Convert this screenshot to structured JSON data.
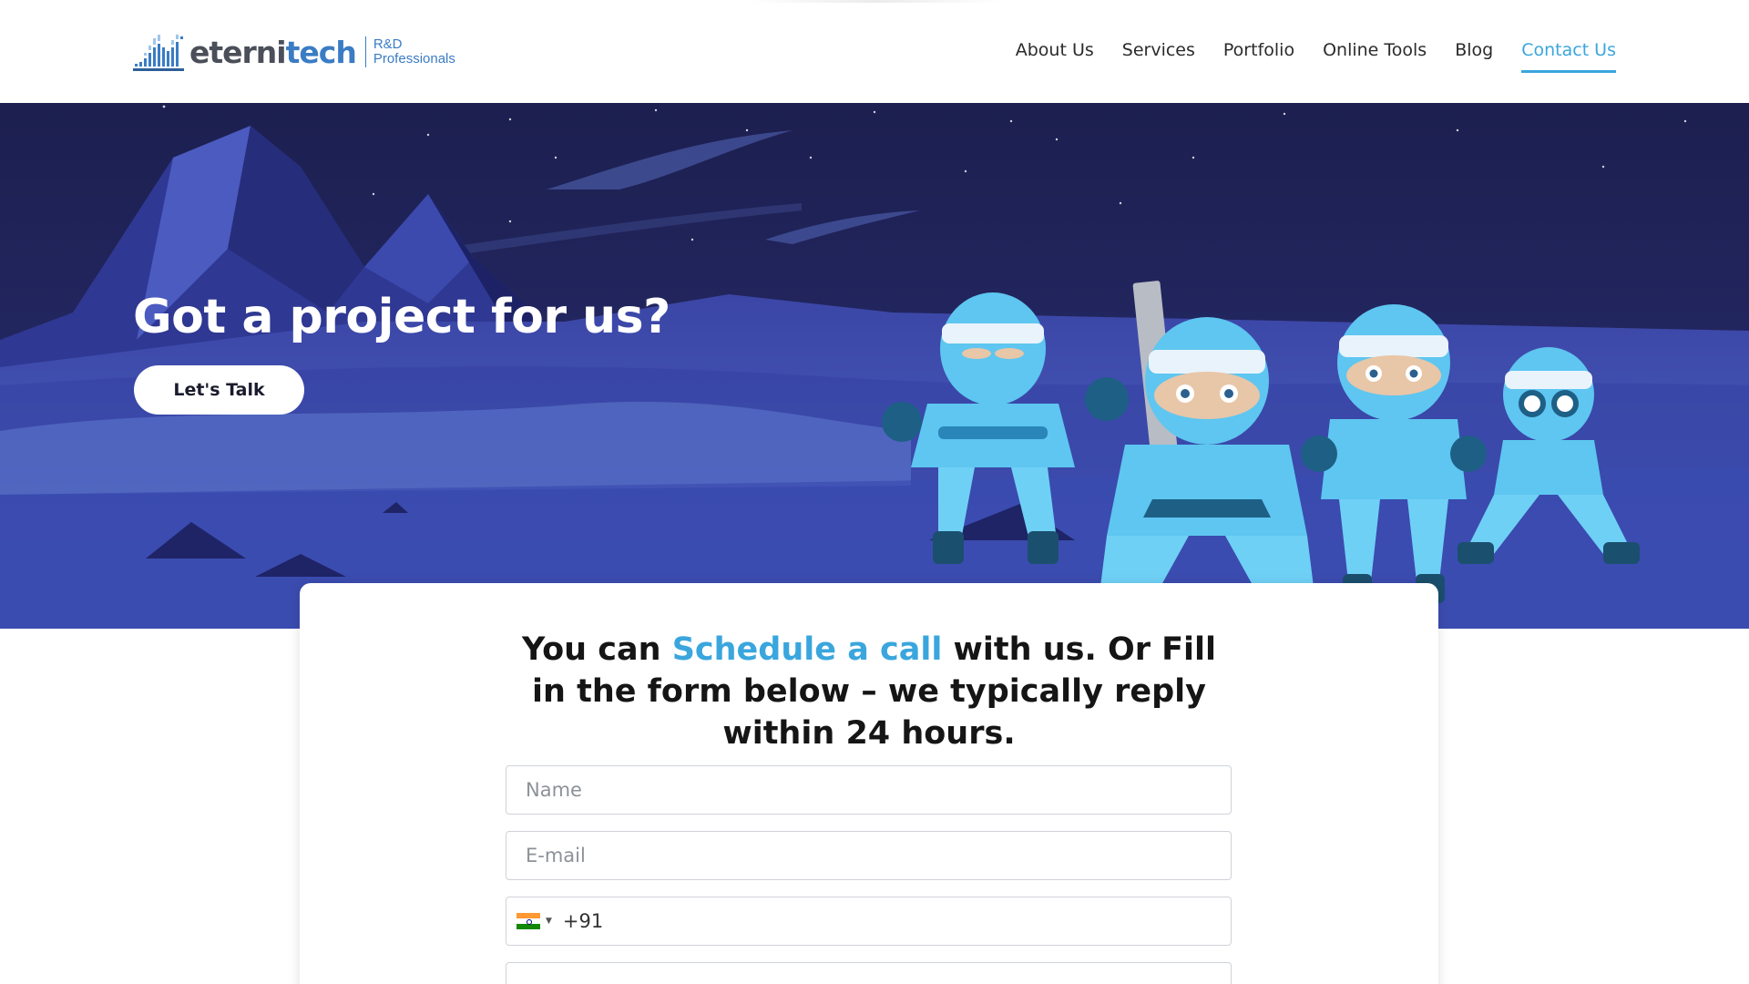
{
  "header": {
    "logo": {
      "brand_prefix": "eterni",
      "brand_suffix": "tech",
      "tagline_line1": "R&D",
      "tagline_line2": "Professionals"
    },
    "nav": [
      {
        "label": "About Us",
        "active": false
      },
      {
        "label": "Services",
        "active": false
      },
      {
        "label": "Portfolio",
        "active": false
      },
      {
        "label": "Online Tools",
        "active": false
      },
      {
        "label": "Blog",
        "active": false
      },
      {
        "label": "Contact Us",
        "active": true
      }
    ]
  },
  "hero": {
    "title": "Got a project for us?",
    "cta_label": "Let's Talk"
  },
  "form": {
    "heading_before": "You can ",
    "heading_link": "Schedule a call",
    "heading_after_line1": " with us. Or Fill",
    "heading_line2": "in the form below – we typically reply",
    "heading_line3": "within 24 hours.",
    "name_placeholder": "Name",
    "email_placeholder": "E-mail",
    "phone_country": "india-flag-icon",
    "phone_value": "+91"
  },
  "colors": {
    "accent": "#3aa6dd",
    "hero_bg": "#1f2257",
    "text": "#151515"
  }
}
